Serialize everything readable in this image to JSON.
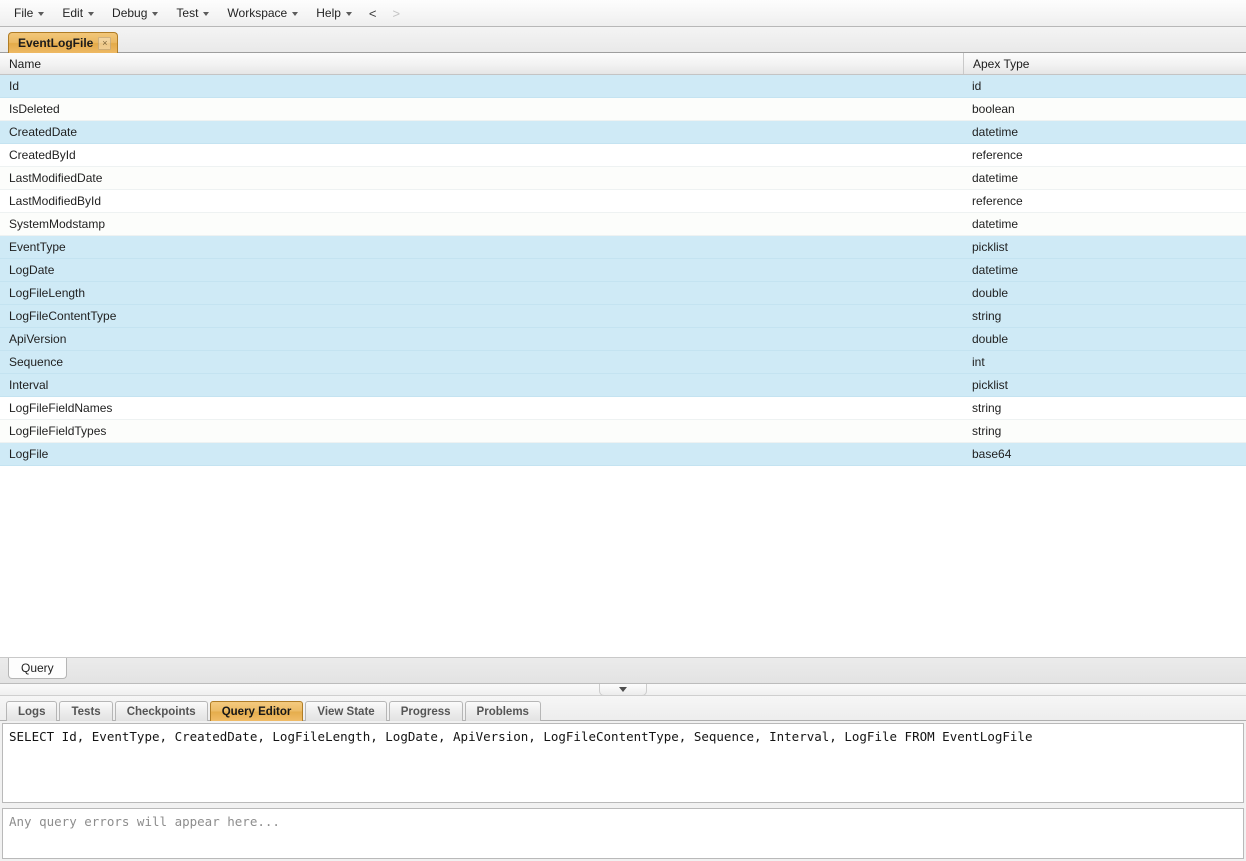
{
  "menubar": {
    "items": [
      {
        "label": "File",
        "has_caret": true
      },
      {
        "label": "Edit",
        "has_caret": true
      },
      {
        "label": "Debug",
        "has_caret": true
      },
      {
        "label": "Test",
        "has_caret": true
      },
      {
        "label": "Workspace",
        "has_caret": true
      },
      {
        "label": "Help",
        "has_caret": true
      }
    ],
    "nav_back": "<",
    "nav_forward": ">"
  },
  "document_tabs": [
    {
      "label": "EventLogFile",
      "active": true,
      "close_glyph": "×"
    }
  ],
  "schema_table": {
    "columns": [
      "Name",
      "Apex Type"
    ],
    "rows": [
      {
        "name": "Id",
        "type": "id",
        "selected": true
      },
      {
        "name": "IsDeleted",
        "type": "boolean",
        "selected": false
      },
      {
        "name": "CreatedDate",
        "type": "datetime",
        "selected": true
      },
      {
        "name": "CreatedById",
        "type": "reference",
        "selected": false
      },
      {
        "name": "LastModifiedDate",
        "type": "datetime",
        "selected": false
      },
      {
        "name": "LastModifiedById",
        "type": "reference",
        "selected": false
      },
      {
        "name": "SystemModstamp",
        "type": "datetime",
        "selected": false
      },
      {
        "name": "EventType",
        "type": "picklist",
        "selected": true
      },
      {
        "name": "LogDate",
        "type": "datetime",
        "selected": true
      },
      {
        "name": "LogFileLength",
        "type": "double",
        "selected": true
      },
      {
        "name": "LogFileContentType",
        "type": "string",
        "selected": true
      },
      {
        "name": "ApiVersion",
        "type": "double",
        "selected": true
      },
      {
        "name": "Sequence",
        "type": "int",
        "selected": true
      },
      {
        "name": "Interval",
        "type": "picklist",
        "selected": true
      },
      {
        "name": "LogFileFieldNames",
        "type": "string",
        "selected": false
      },
      {
        "name": "LogFileFieldTypes",
        "type": "string",
        "selected": false
      },
      {
        "name": "LogFile",
        "type": "base64",
        "selected": true
      }
    ]
  },
  "sub_tabs": [
    {
      "label": "Query",
      "active": true
    }
  ],
  "panel_tabs": [
    {
      "label": "Logs",
      "active": false
    },
    {
      "label": "Tests",
      "active": false
    },
    {
      "label": "Checkpoints",
      "active": false
    },
    {
      "label": "Query Editor",
      "active": true
    },
    {
      "label": "View State",
      "active": false
    },
    {
      "label": "Progress",
      "active": false
    },
    {
      "label": "Problems",
      "active": false
    }
  ],
  "query_editor": {
    "value": "SELECT Id, EventType, CreatedDate, LogFileLength, LogDate, ApiVersion, LogFileContentType, Sequence, Interval, LogFile FROM EventLogFile"
  },
  "error_panel": {
    "placeholder": "Any query errors will appear here..."
  },
  "colors": {
    "accent_tab": "#e8b45a",
    "row_selected": "#cfeaf6",
    "row_plain": "#fcfdfb",
    "chrome": "#ededed",
    "muted_text": "#8d8d8d"
  }
}
